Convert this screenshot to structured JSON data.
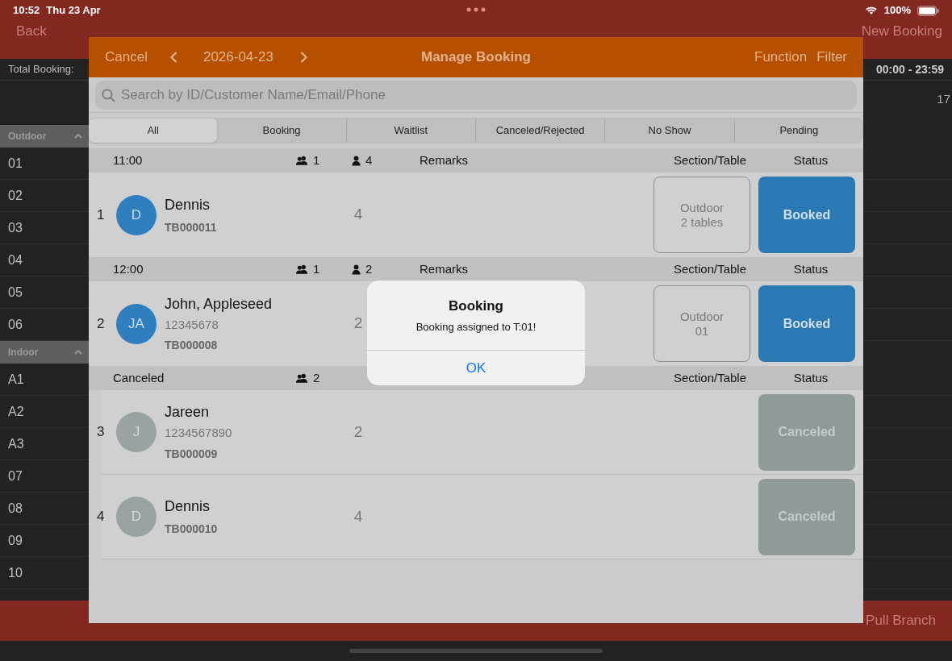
{
  "status_bar": {
    "time": "10:52",
    "date": "Thu 23 Apr",
    "battery": "100%"
  },
  "background": {
    "nav": {
      "back": "Back",
      "new_booking": "New Booking"
    },
    "summary": {
      "label": "Total Booking:",
      "time_range": "00:00 - 23:59"
    },
    "timeline_tick": "17",
    "sections": [
      {
        "name": "Outdoor",
        "expanded": true,
        "tables": [
          "01",
          "02",
          "03",
          "04",
          "05",
          "06"
        ]
      },
      {
        "name": "Indoor",
        "expanded": true,
        "tables": [
          "A1",
          "A2",
          "A3",
          "07",
          "08",
          "09",
          "10"
        ]
      }
    ],
    "bottom_bar": {
      "right": "Pull Branch"
    }
  },
  "modal": {
    "cancel": "Cancel",
    "date": "2026-04-23",
    "title": "Manage Booking",
    "actions": [
      "Function",
      "Filter"
    ],
    "search": {
      "placeholder": "Search by ID/Customer Name/Email/Phone"
    },
    "tabs": [
      {
        "label": "All",
        "selected": true
      },
      {
        "label": "Booking",
        "selected": false
      },
      {
        "label": "Waitlist",
        "selected": false
      },
      {
        "label": "Canceled/Rejected",
        "selected": false
      },
      {
        "label": "No Show",
        "selected": false
      },
      {
        "label": "Pending",
        "selected": false
      }
    ],
    "groups": [
      {
        "title": "11:00",
        "groups_count": "1",
        "pax": "4",
        "remarks_label": "Remarks",
        "section_label": "Section/Table",
        "status_label": "Status",
        "bookings": [
          {
            "index": "1",
            "initials": "D",
            "name": "Dennis",
            "id": "TB000011",
            "pax": "4",
            "table": [
              "Outdoor",
              "2 tables"
            ],
            "status": "Booked",
            "kind": "booked"
          }
        ]
      },
      {
        "title": "12:00",
        "groups_count": "1",
        "pax": "2",
        "remarks_label": "Remarks",
        "section_label": "Section/Table",
        "status_label": "Status",
        "bookings": [
          {
            "index": "2",
            "initials": "JA",
            "name": "John, Appleseed",
            "phone": "12345678",
            "id": "TB000008",
            "pax": "2",
            "table": [
              "Outdoor",
              "01"
            ],
            "status": "Booked",
            "kind": "booked"
          }
        ]
      },
      {
        "title": "Canceled",
        "groups_count": "2",
        "section_label": "Section/Table",
        "status_label": "Status",
        "bookings": [
          {
            "index": "3",
            "initials": "J",
            "name": "Jareen",
            "phone": "1234567890",
            "id": "TB000009",
            "pax": "2",
            "status": "Canceled",
            "kind": "canceled"
          },
          {
            "index": "4",
            "initials": "D",
            "name": "Dennis",
            "id": "TB000010",
            "pax": "4",
            "status": "Canceled",
            "kind": "canceled"
          }
        ]
      }
    ]
  },
  "alert": {
    "title": "Booking",
    "message": "Booking assigned to T:01!",
    "button": "OK"
  }
}
